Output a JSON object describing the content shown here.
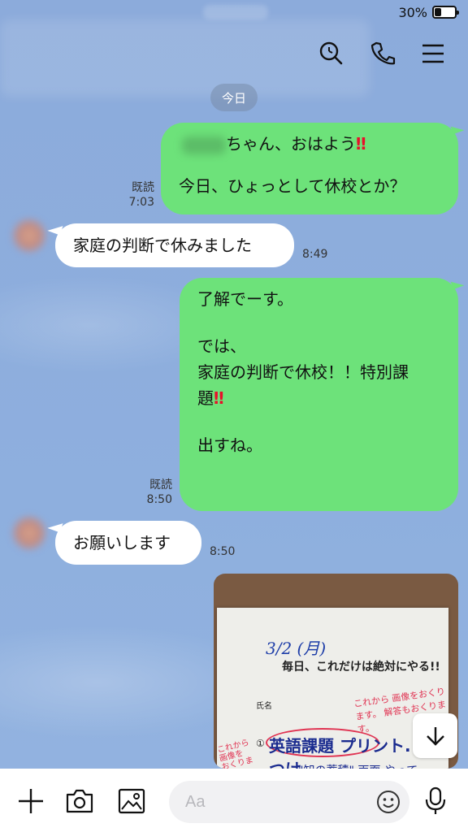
{
  "status_bar": {
    "battery_pct": "30%",
    "battery_level": 0.3
  },
  "header": {
    "icons": [
      "search-icon",
      "phone-icon",
      "menu-icon"
    ]
  },
  "date_chip": "今日",
  "messages": [
    {
      "dir": "out",
      "name_suffix": "ちゃん、おはよう",
      "emphasis": "‼",
      "line2": "今日、ひょっとして休校とか？",
      "read": "既読",
      "time": "7:03"
    },
    {
      "dir": "in",
      "text": "家庭の判断で休みました",
      "time": "8:49"
    },
    {
      "dir": "out",
      "lines": [
        "了解でーす。",
        "",
        "では、",
        "家庭の判断で休校！！特別課",
        "題",
        "",
        "出すね。"
      ],
      "emphasis": "‼",
      "read": "既読",
      "time": "8:50"
    },
    {
      "dir": "in",
      "text": "お願いします",
      "time": "8:50"
    }
  ],
  "photo": {
    "date": "3/2 (月)",
    "title": "毎日、これだけは絶対にやる!!",
    "name_label": "氏名",
    "red_note1": "これから 画像をおくります。 解答もおくります。",
    "red_note2": "これから 画像を おくります",
    "item_num": "①",
    "item1": "英語課題 プリント. 丸つけ",
    "item2": "\"知の蓄積\" 両面 やって"
  },
  "input": {
    "placeholder": "Aa"
  },
  "bottom_icons": [
    "plus-icon",
    "camera-icon",
    "image-icon",
    "emoji-icon",
    "microphone-icon"
  ],
  "colors": {
    "outgoing": "#6de27a",
    "incoming": "#ffffff",
    "background": "#8fb0de",
    "emphasis": "#e8102a"
  }
}
